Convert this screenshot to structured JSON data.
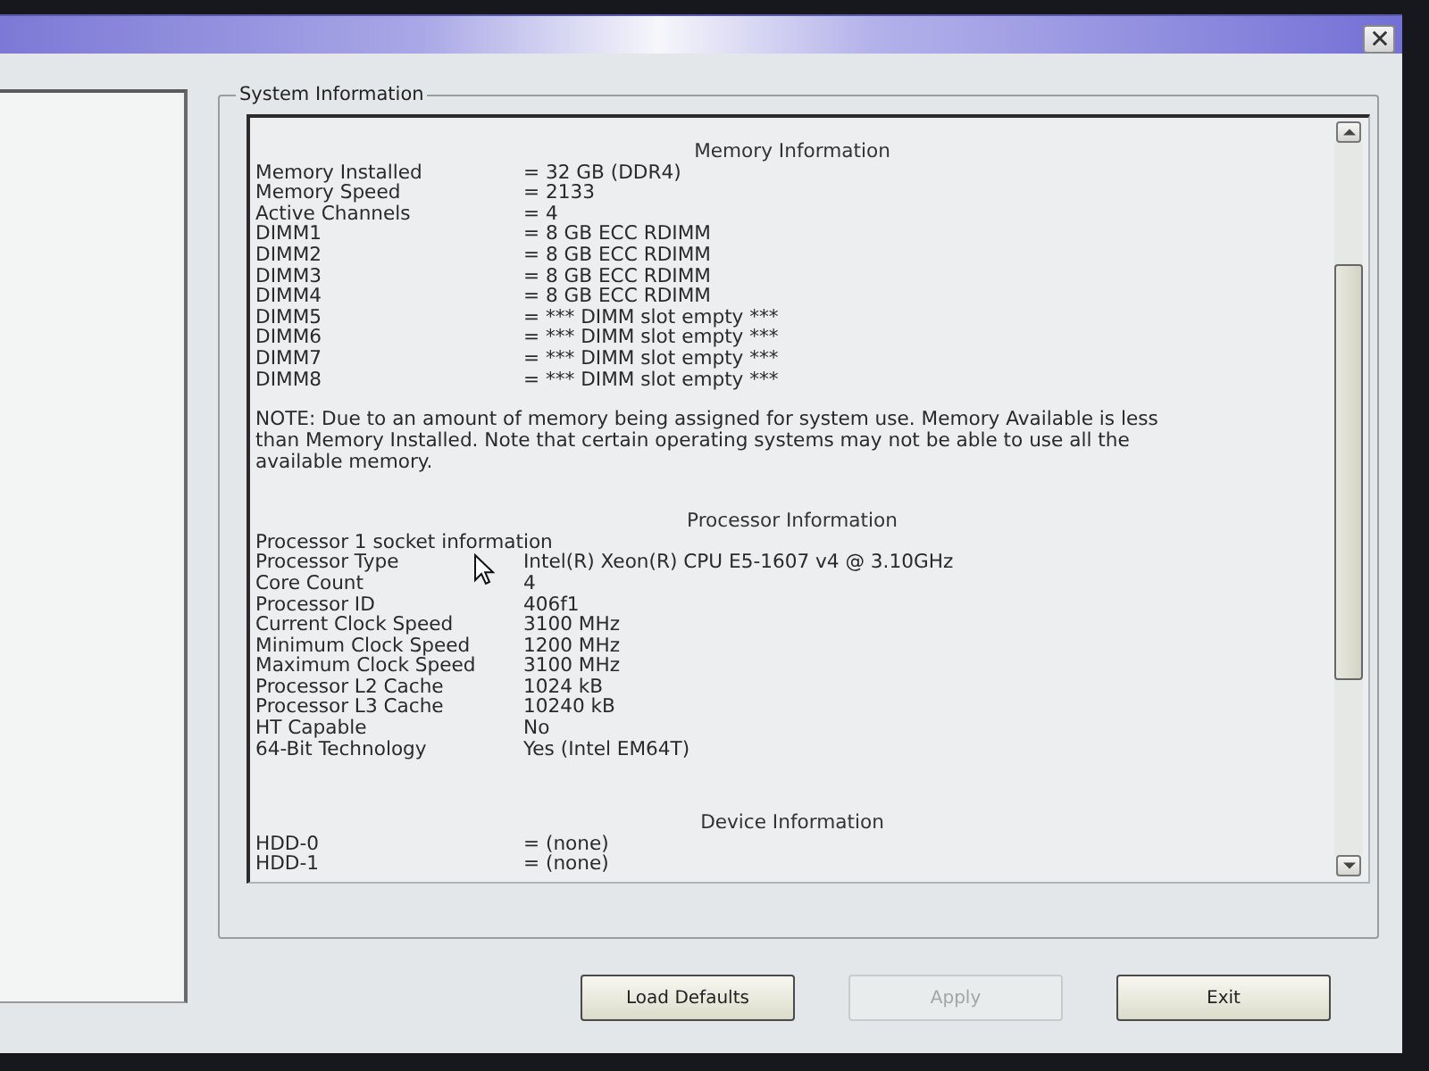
{
  "group": {
    "title": "System Information",
    "blocks": [
      {
        "kind": "heading",
        "text": "Memory Information"
      },
      {
        "kind": "table",
        "rows": [
          {
            "label": "Memory Installed",
            "value": "= 32 GB (DDR4)"
          },
          {
            "label": "Memory Speed",
            "value": "= 2133"
          },
          {
            "label": "Active Channels",
            "value": "= 4"
          },
          {
            "label": "DIMM1",
            "value": "= 8 GB ECC RDIMM"
          },
          {
            "label": "DIMM2",
            "value": "= 8 GB ECC RDIMM"
          },
          {
            "label": "DIMM3",
            "value": "= 8 GB ECC RDIMM"
          },
          {
            "label": "DIMM4",
            "value": "= 8 GB ECC RDIMM"
          },
          {
            "label": "DIMM5",
            "value": "= *** DIMM slot empty ***"
          },
          {
            "label": "DIMM6",
            "value": "= *** DIMM slot empty ***"
          },
          {
            "label": "DIMM7",
            "value": "= *** DIMM slot empty ***"
          },
          {
            "label": "DIMM8",
            "value": "= *** DIMM slot empty ***"
          }
        ]
      },
      {
        "kind": "note",
        "text": "NOTE: Due to an amount of memory being assigned for system use. Memory Available is less than Memory Installed. Note that certain operating systems may not be able to use all the available memory."
      },
      {
        "kind": "heading",
        "text": "Processor Information"
      },
      {
        "kind": "table",
        "rows": [
          {
            "label": "Processor 1 socket information"
          },
          {
            "label": "Processor Type",
            "value": "Intel(R) Xeon(R) CPU E5-1607 v4 @ 3.10GHz"
          },
          {
            "label": "Core Count",
            "value": "4"
          },
          {
            "label": "Processor ID",
            "value": "406f1"
          },
          {
            "label": "Current Clock Speed",
            "value": "3100 MHz"
          },
          {
            "label": "Minimum Clock Speed",
            "value": "1200 MHz"
          },
          {
            "label": "Maximum Clock Speed",
            "value": "3100 MHz"
          },
          {
            "label": "Processor L2 Cache",
            "value": "1024 kB"
          },
          {
            "label": "Processor L3 Cache",
            "value": "10240 kB"
          },
          {
            "label": "HT Capable",
            "value": "No"
          },
          {
            "label": "64-Bit Technology",
            "value": "Yes (Intel EM64T)"
          }
        ]
      },
      {
        "kind": "heading",
        "text": "Device Information"
      },
      {
        "kind": "table",
        "rows": [
          {
            "label": "HDD-0",
            "value": "= (none)"
          },
          {
            "label": "HDD-1",
            "value": "= (none)"
          }
        ]
      }
    ]
  },
  "buttons": [
    {
      "label": "Load Defaults",
      "disabled": false
    },
    {
      "label": "Apply",
      "disabled": true
    },
    {
      "label": "Exit",
      "disabled": false
    }
  ]
}
